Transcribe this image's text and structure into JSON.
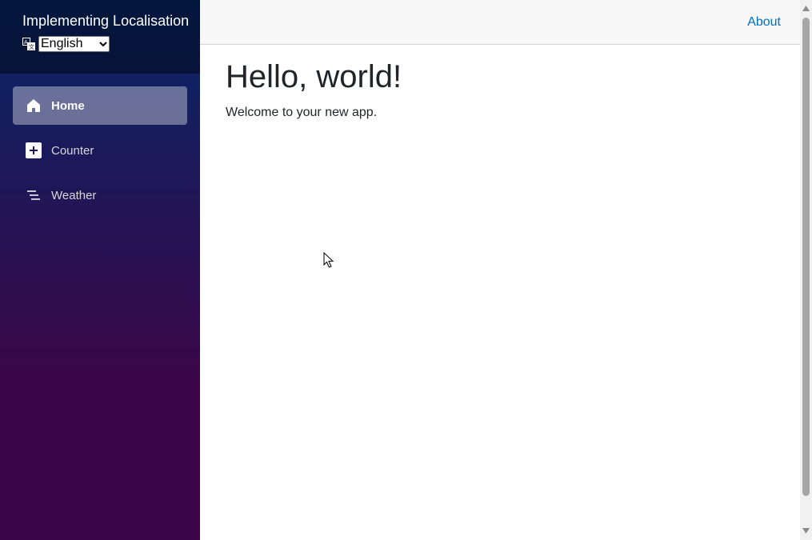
{
  "sidebar": {
    "brand": "Implementing Localisation",
    "language_select": {
      "selected": "English",
      "icon": "translate-icon"
    },
    "items": [
      {
        "label": "Home",
        "icon": "home-icon",
        "active": true
      },
      {
        "label": "Counter",
        "icon": "plus-square-icon",
        "active": false
      },
      {
        "label": "Weather",
        "icon": "list-lines-icon",
        "active": false
      }
    ]
  },
  "top_row": {
    "about_label": "About"
  },
  "main": {
    "heading": "Hello, world!",
    "body": "Welcome to your new app."
  },
  "colors": {
    "sidebar_gradient_top": "#052767",
    "sidebar_gradient_bottom": "#3a0647",
    "link": "#0071c1"
  }
}
